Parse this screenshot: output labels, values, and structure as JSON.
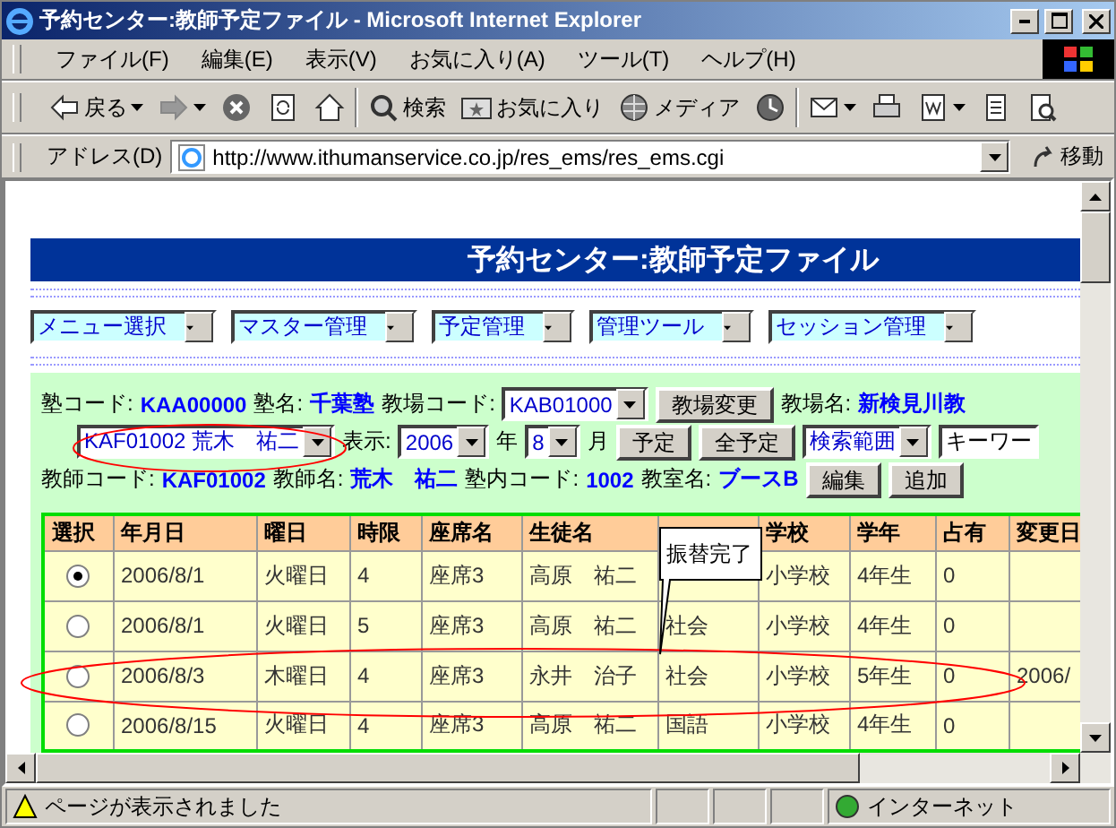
{
  "window": {
    "title": "予約センター:教師予定ファイル - Microsoft Internet Explorer"
  },
  "menu": [
    "ファイル(F)",
    "編集(E)",
    "表示(V)",
    "お気に入り(A)",
    "ツール(T)",
    "ヘルプ(H)"
  ],
  "toolbar": [
    {
      "kind": "back",
      "label": "戻る"
    },
    {
      "kind": "forward"
    },
    {
      "kind": "stop"
    },
    {
      "kind": "refresh"
    },
    {
      "kind": "home"
    },
    {
      "kind": "sep"
    },
    {
      "kind": "search",
      "label": "検索"
    },
    {
      "kind": "favorites",
      "label": "お気に入り"
    },
    {
      "kind": "media",
      "label": "メディア"
    },
    {
      "kind": "history"
    },
    {
      "kind": "sep"
    },
    {
      "kind": "mail"
    },
    {
      "kind": "print"
    },
    {
      "kind": "edit"
    },
    {
      "kind": "discuss"
    },
    {
      "kind": "research"
    }
  ],
  "address": {
    "label": "アドレス(D)",
    "url": "http://www.ithumanservice.co.jp/res_ems/res_ems.cgi",
    "go": "移動"
  },
  "page": {
    "banner": "予約センター:教師予定ファイル",
    "menus": [
      "メニュー選択",
      "マスター管理",
      "予定管理",
      "管理ツール",
      "セッション管理"
    ],
    "info": [
      [
        {
          "kind": "label",
          "text": "塾コード:"
        },
        {
          "kind": "value",
          "text": "KAA00000"
        },
        {
          "kind": "label",
          "text": "塾名:"
        },
        {
          "kind": "value",
          "text": "千葉塾"
        },
        {
          "kind": "label",
          "text": "教場コード:"
        },
        {
          "kind": "select",
          "text": "KAB01000"
        },
        {
          "kind": "button",
          "text": "教場変更"
        },
        {
          "kind": "label",
          "text": "教場名:"
        },
        {
          "kind": "value",
          "text": "新検見川教"
        }
      ],
      [
        {
          "kind": "select",
          "text": "KAF01002 荒木　祐二"
        },
        {
          "kind": "label",
          "text": "表示:"
        },
        {
          "kind": "select",
          "text": "2006"
        },
        {
          "kind": "label",
          "text": "年"
        },
        {
          "kind": "select",
          "text": "8"
        },
        {
          "kind": "label",
          "text": "月"
        },
        {
          "kind": "button",
          "text": "予定"
        },
        {
          "kind": "button",
          "text": "全予定"
        },
        {
          "kind": "select",
          "text": "検索範囲"
        },
        {
          "kind": "input",
          "text": "キーワー"
        }
      ],
      [
        {
          "kind": "label",
          "text": "教師コード:"
        },
        {
          "kind": "value",
          "text": "KAF01002"
        },
        {
          "kind": "label",
          "text": "教師名:"
        },
        {
          "kind": "value",
          "text": "荒木　祐二"
        },
        {
          "kind": "label",
          "text": "塾内コード:"
        },
        {
          "kind": "value",
          "text": "1002"
        },
        {
          "kind": "label",
          "text": "教室名:"
        },
        {
          "kind": "value",
          "text": "ブースB"
        },
        {
          "kind": "button",
          "text": "編集"
        },
        {
          "kind": "button",
          "text": "追加"
        }
      ]
    ],
    "table": {
      "columns": [
        "選択",
        "年月日",
        "曜日",
        "時限",
        "座席名",
        "生徒名",
        "",
        "学校",
        "学年",
        "占有",
        "変更日"
      ],
      "rows": [
        {
          "selected": true,
          "cells": [
            "",
            "2006/8/1",
            "火曜日",
            "4",
            "座席3",
            "高原　祐二",
            "",
            "小学校",
            "4年生",
            "0",
            ""
          ]
        },
        {
          "selected": false,
          "cells": [
            "",
            "2006/8/1",
            "火曜日",
            "5",
            "座席3",
            "高原　祐二",
            "社会",
            "小学校",
            "4年生",
            "0",
            ""
          ]
        },
        {
          "selected": false,
          "cells": [
            "",
            "2006/8/3",
            "木曜日",
            "4",
            "座席3",
            "永井　治子",
            "社会",
            "小学校",
            "5年生",
            "0",
            "2006/"
          ]
        },
        {
          "selected": false,
          "cells": [
            "",
            "2006/8/15",
            "火曜日",
            "4",
            "座席3",
            "高原　祐二",
            "国語",
            "小学校",
            "4年生",
            "0",
            ""
          ]
        }
      ]
    },
    "annotations": [
      {
        "kind": "ellipse"
      },
      {
        "kind": "ellipse"
      },
      {
        "kind": "callout",
        "text": "振替完了"
      }
    ]
  },
  "status": {
    "text": "ページが表示されました",
    "zone": "インターネット"
  }
}
